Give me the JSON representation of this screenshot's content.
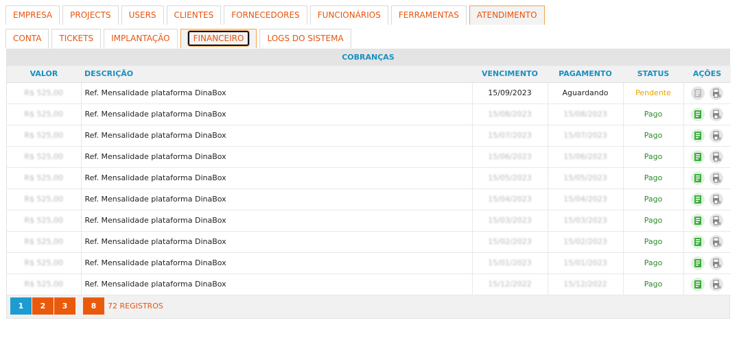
{
  "tabs_primary": [
    "EMPRESA",
    "PROJECTS",
    "USERS",
    "CLIENTES",
    "FORNECEDORES",
    "FUNCIONÁRIOS",
    "FERRAMENTAS",
    "ATENDIMENTO"
  ],
  "tabs_primary_active": "ATENDIMENTO",
  "tabs_secondary": [
    "CONTA",
    "TICKETS",
    "IMPLANTAÇÃO",
    "FINANCEIRO",
    "LOGS DO SISTEMA"
  ],
  "tabs_secondary_active": "FINANCEIRO",
  "panel_title": "COBRANÇAS",
  "columns": [
    "VALOR",
    "DESCRIÇÃO",
    "VENCIMENTO",
    "PAGAMENTO",
    "STATUS",
    "AÇÕES"
  ],
  "rows": [
    {
      "valor": "R$ 525,00",
      "descricao": "Ref. Mensalidade plataforma DinaBox",
      "vencimento": "15/09/2023",
      "pagamento": "Aguardando",
      "status": "Pendente",
      "status_color": "#e8a200",
      "blurred_dates": false
    },
    {
      "valor": "R$ 525,00",
      "descricao": "Ref. Mensalidade plataforma DinaBox",
      "vencimento": "15/08/2023",
      "pagamento": "15/08/2023",
      "status": "Pago",
      "status_color": "#2a8a2a",
      "blurred_dates": true
    },
    {
      "valor": "R$ 525,00",
      "descricao": "Ref. Mensalidade plataforma DinaBox",
      "vencimento": "15/07/2023",
      "pagamento": "15/07/2023",
      "status": "Pago",
      "status_color": "#2a8a2a",
      "blurred_dates": true
    },
    {
      "valor": "R$ 525,00",
      "descricao": "Ref. Mensalidade plataforma DinaBox",
      "vencimento": "15/06/2023",
      "pagamento": "15/06/2023",
      "status": "Pago",
      "status_color": "#2a8a2a",
      "blurred_dates": true
    },
    {
      "valor": "R$ 525,00",
      "descricao": "Ref. Mensalidade plataforma DinaBox",
      "vencimento": "15/05/2023",
      "pagamento": "15/05/2023",
      "status": "Pago",
      "status_color": "#2a8a2a",
      "blurred_dates": true
    },
    {
      "valor": "R$ 525,00",
      "descricao": "Ref. Mensalidade plataforma DinaBox",
      "vencimento": "15/04/2023",
      "pagamento": "15/04/2023",
      "status": "Pago",
      "status_color": "#2a8a2a",
      "blurred_dates": true
    },
    {
      "valor": "R$ 525,00",
      "descricao": "Ref. Mensalidade plataforma DinaBox",
      "vencimento": "15/03/2023",
      "pagamento": "15/03/2023",
      "status": "Pago",
      "status_color": "#2a8a2a",
      "blurred_dates": true
    },
    {
      "valor": "R$ 525,00",
      "descricao": "Ref. Mensalidade plataforma DinaBox",
      "vencimento": "15/02/2023",
      "pagamento": "15/02/2023",
      "status": "Pago",
      "status_color": "#2a8a2a",
      "blurred_dates": true
    },
    {
      "valor": "R$ 525,00",
      "descricao": "Ref. Mensalidade plataforma DinaBox",
      "vencimento": "15/01/2023",
      "pagamento": "15/01/2023",
      "status": "Pago",
      "status_color": "#2a8a2a",
      "blurred_dates": true
    },
    {
      "valor": "R$ 525,00",
      "descricao": "Ref. Mensalidade plataforma DinaBox",
      "vencimento": "15/12/2022",
      "pagamento": "15/12/2022",
      "status": "Pago",
      "status_color": "#2a8a2a",
      "blurred_dates": true
    }
  ],
  "row_actions": {
    "boleto_icon": "boleto-icon",
    "print_icon": "print-icon"
  },
  "pagination": {
    "pages": [
      "1",
      "2",
      "3"
    ],
    "current": "1",
    "total_pages": "8",
    "records_label": "72 REGISTROS"
  },
  "colors": {
    "accent": "#e8540d",
    "header_blue": "#1a8fc0",
    "pager_blue": "#1e9bd1",
    "pending": "#e8a200",
    "paid": "#2a8a2a"
  }
}
